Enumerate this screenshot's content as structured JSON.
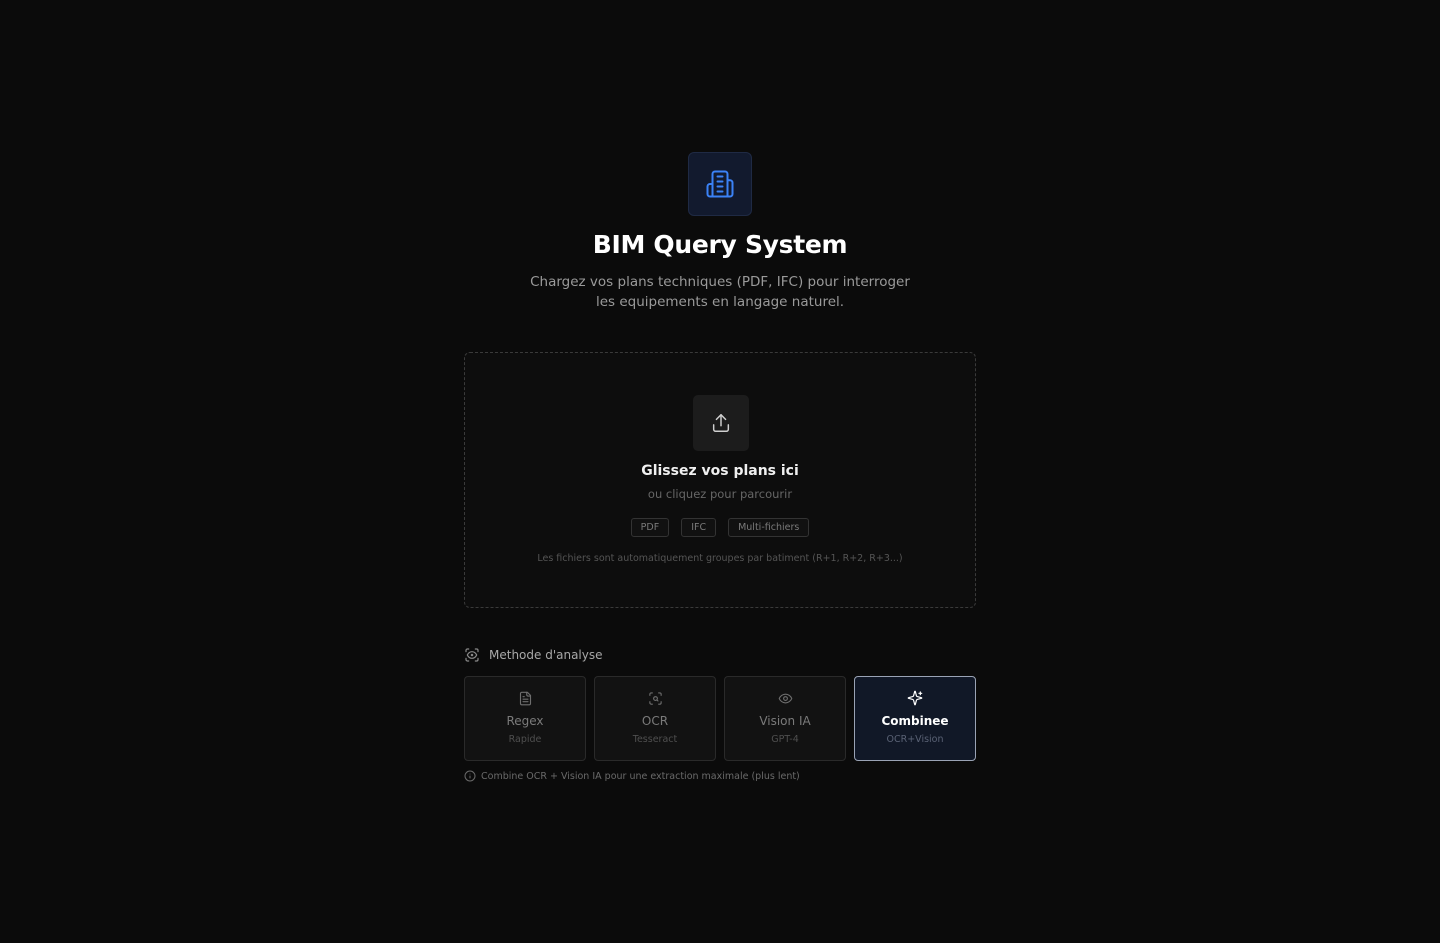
{
  "header": {
    "title": "BIM Query System",
    "subtitle": "Chargez vos plans techniques (PDF, IFC) pour interroger les equipements en langage naturel.",
    "logo_icon": "building-icon",
    "accent_color": "#3b82f6"
  },
  "dropzone": {
    "upload_icon": "upload-icon",
    "title": "Glissez vos plans ici",
    "hint": "ou cliquez pour parcourir",
    "tags": [
      "PDF",
      "IFC",
      "Multi-fichiers"
    ],
    "note": "Les fichiers sont automatiquement groupes par batiment (R+1, R+2, R+3...)"
  },
  "analysis": {
    "label": "Methode d'analyse",
    "label_icon": "scan-eye-icon",
    "selected": "Combinee",
    "options": [
      {
        "name": "Regex",
        "sub": "Rapide",
        "icon": "file-text-icon"
      },
      {
        "name": "OCR",
        "sub": "Tesseract",
        "icon": "scan-search-icon"
      },
      {
        "name": "Vision IA",
        "sub": "GPT-4",
        "icon": "eye-icon"
      },
      {
        "name": "Combinee",
        "sub": "OCR+Vision",
        "icon": "sparkles-icon"
      }
    ],
    "info_icon": "info-icon",
    "info": "Combine OCR + Vision IA pour une extraction maximale (plus lent)"
  }
}
